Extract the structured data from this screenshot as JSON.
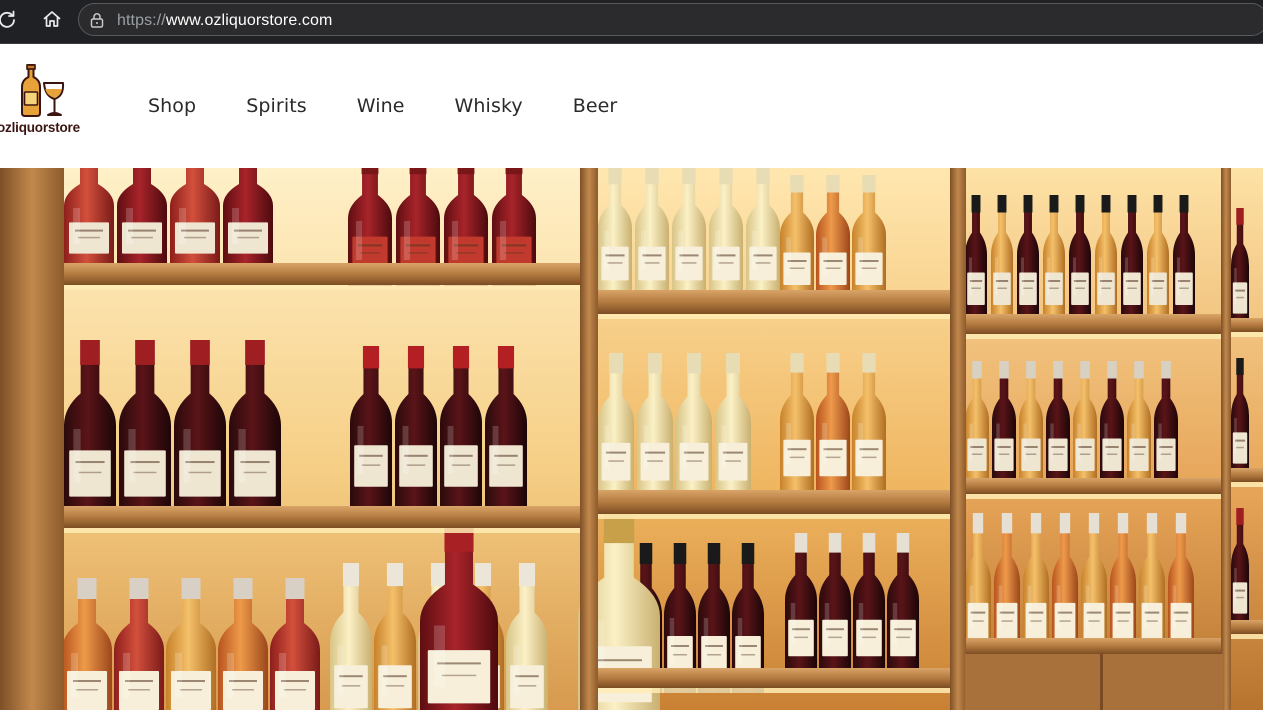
{
  "browser": {
    "url_scheme": "https://",
    "url_host": "www.ozliquorstore.com",
    "icons": {
      "reload": "reload-icon",
      "home": "home-icon",
      "site_info": "lock-icon"
    },
    "colors": {
      "toolbar": "#202124",
      "address_bar": "#2b2b2d"
    }
  },
  "site": {
    "logo": {
      "text": "ozliquorstore",
      "icon": "bottle-and-wine-glass-icon"
    },
    "nav": {
      "items": [
        {
          "label": "Shop"
        },
        {
          "label": "Spirits"
        },
        {
          "label": "Wine"
        },
        {
          "label": "Whisky"
        },
        {
          "label": "Beer"
        }
      ]
    },
    "colors": {
      "brand_text": "#3a1410",
      "logo_accent": "#e8a23a"
    }
  },
  "hero": {
    "image": "photo-of-illuminated-wooden-shelves-stocked-with-wine-bottles",
    "colors": {
      "wood": "#b07a45",
      "backlight": "#f7d48a"
    }
  }
}
